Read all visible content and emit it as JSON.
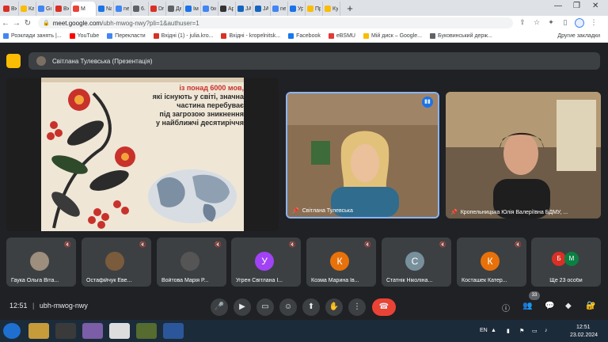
{
  "browser": {
    "tabs": [
      {
        "label": "Вхі",
        "color": "#d93025"
      },
      {
        "label": "Кар",
        "color": "#fbbc04"
      },
      {
        "label": "Go",
        "color": "#4285f4"
      },
      {
        "label": "Вхі",
        "color": "#d93025"
      },
      {
        "label": "М",
        "color": "#ea4335",
        "active": true
      },
      {
        "label": "Na",
        "color": "#1a73e8"
      },
      {
        "label": "nev",
        "color": "#4285f4"
      },
      {
        "label": "6. С",
        "color": "#5f6368"
      },
      {
        "label": "Dr",
        "color": "#d93025"
      },
      {
        "label": "Де",
        "color": "#5f6368"
      },
      {
        "label": "Ім",
        "color": "#1a73e8"
      },
      {
        "label": "біо",
        "color": "#4285f4"
      },
      {
        "label": "Ар",
        "color": "#333333"
      },
      {
        "label": "JAC",
        "color": "#1565c0"
      },
      {
        "label": "JAC",
        "color": "#1565c0"
      },
      {
        "label": "nev",
        "color": "#4285f4"
      },
      {
        "label": "Урс",
        "color": "#1a73e8"
      },
      {
        "label": "Пр",
        "color": "#fbbc04"
      },
      {
        "label": "Кур",
        "color": "#fbbc04"
      }
    ],
    "url_host": "meet.google.com",
    "url_path": "/ubh-mwog-nwy?pli=1&authuser=1",
    "bookmarks": [
      {
        "label": "Розклади занять |...",
        "color": "#4285f4"
      },
      {
        "label": "YouTube",
        "color": "#ff0000"
      },
      {
        "label": "Перекласти",
        "color": "#4285f4"
      },
      {
        "label": "Вхідні (1) - julia.kro...",
        "color": "#d93025"
      },
      {
        "label": "Вхідні - kropelnitsk...",
        "color": "#d93025"
      },
      {
        "label": "Facebook",
        "color": "#1877f2"
      },
      {
        "label": "eBSMU",
        "color": "#e53935"
      },
      {
        "label": "Мій диск – Google...",
        "color": "#fbbc04"
      },
      {
        "label": "Буковинський держ...",
        "color": "#5f6368"
      }
    ],
    "bookmarks_other": "Другие закладки"
  },
  "meet": {
    "presenter_label": "Світлана Тулевська (Презентація)",
    "slide_text": [
      "із понад 6000 мов,",
      "які існують у світі, значна",
      "частина перебуває",
      "під загрозою зникнення",
      "у найближчі десятиріччя"
    ],
    "main_tiles": [
      {
        "name": "Світлана Тулевська"
      },
      {
        "name": "Кропельницька Юлія Валеріївна БДМУ, ..."
      }
    ],
    "participants": [
      {
        "name": "Гаука Ольга Віта...",
        "initial": "",
        "color": "#9e8e7e"
      },
      {
        "name": "Остафійчук Еве...",
        "initial": "",
        "color": "#7a5b3c"
      },
      {
        "name": "Войтова Марія Р...",
        "initial": "",
        "color": "#555555"
      },
      {
        "name": "Угрен Світлана І...",
        "initial": "У",
        "color": "#a142f4"
      },
      {
        "name": "Козма Марина Ів...",
        "initial": "К",
        "color": "#e8710a"
      },
      {
        "name": "Статнік Ніколіна...",
        "initial": "С",
        "color": "#78909c"
      },
      {
        "name": "Косташек Катер...",
        "initial": "К",
        "color": "#e8710a"
      }
    ],
    "others": {
      "label": "Ще 23 особи",
      "a": "Б",
      "b": "М"
    },
    "time": "12:51",
    "code": "ubh-mwog-nwy",
    "participant_count": "33"
  },
  "taskbar": {
    "lang": "EN",
    "clock_time": "12:51",
    "clock_date": "23.02.2024"
  }
}
